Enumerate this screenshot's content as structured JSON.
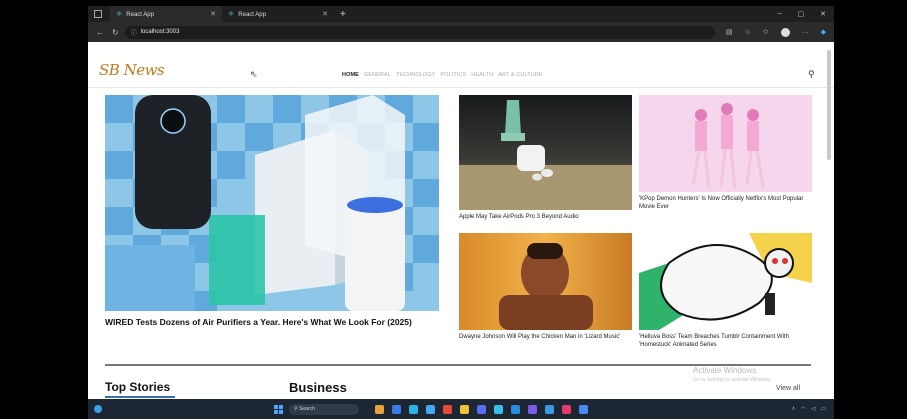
{
  "browser": {
    "tabs": [
      {
        "label": "React App",
        "active": true
      },
      {
        "label": "React App",
        "active": false
      }
    ],
    "url": "localhost:3003"
  },
  "site": {
    "logo": "SB News",
    "menu": [
      "HOME",
      "GENERAL",
      "TECHNOLOGY",
      "POLITICS",
      "HEALTH",
      "ART & CULTURE"
    ],
    "active_menu": "HOME"
  },
  "hero": {
    "title": "WIRED Tests Dozens of Air Purifiers a Year. Here's What We Look For (2025)"
  },
  "cards": [
    {
      "title": "Apple May Take AirPods Pro 3 Beyond Audio"
    },
    {
      "title": "'KPop Demon Hunters' Is Now Officially Netflix's Most Popular Movie Ever"
    },
    {
      "title": "Dwayne Johnson Will Play the Chicken Man in 'Lizard Music'"
    },
    {
      "title": "'Helluva Boss' Team Breaches Tumblr Containment With 'Homestuck' Animated Series"
    }
  ],
  "sections": {
    "top_stories": "Top Stories",
    "business": "Business",
    "view_all": "View all"
  },
  "watermark": {
    "line1": "Activate Windows",
    "line2": "Go to Settings to activate Windows."
  },
  "taskbar": {
    "search": "Search"
  },
  "colors": {
    "logo": "#c07a18",
    "accent": "#3a6fb3"
  }
}
